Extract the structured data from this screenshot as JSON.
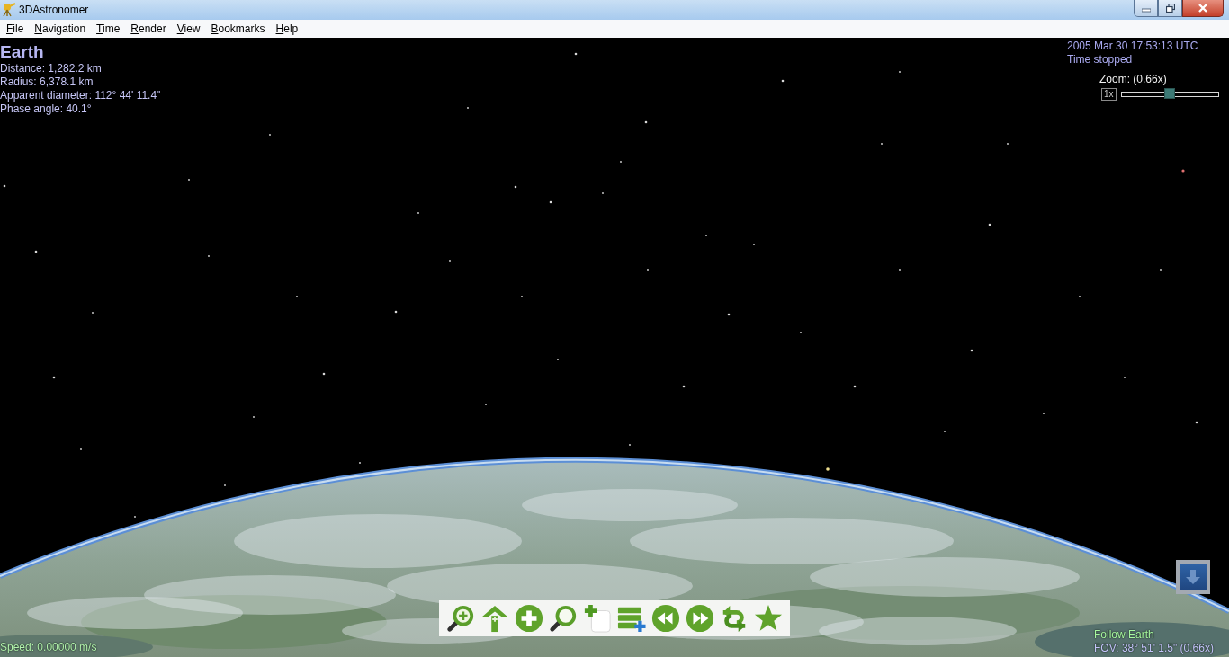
{
  "window": {
    "title": "3DAstronomer",
    "controls": [
      {
        "kind": "minimize"
      },
      {
        "kind": "restore"
      },
      {
        "kind": "close"
      }
    ]
  },
  "menu": [
    "File",
    "Navigation",
    "Time",
    "Render",
    "View",
    "Bookmarks",
    "Help"
  ],
  "object_info": {
    "name": "Earth",
    "lines": [
      "Distance: 1,282.2 km",
      "Radius: 6,378.1 km",
      "Apparent diameter: 112° 44' 11.4\"",
      "Phase angle: 40.1°"
    ]
  },
  "time_info": {
    "datetime": "2005 Mar 30 17:53:13 UTC",
    "status": "Time stopped"
  },
  "zoom": {
    "label": "Zoom: (0.66x)",
    "reset": "1x",
    "level": 0.5
  },
  "toolbar": [
    {
      "kind": "zoom-in"
    },
    {
      "kind": "up"
    },
    {
      "kind": "add"
    },
    {
      "kind": "search"
    },
    {
      "kind": "new-page"
    },
    {
      "kind": "add-list"
    },
    {
      "kind": "rewind"
    },
    {
      "kind": "fast-forward"
    },
    {
      "kind": "swap"
    },
    {
      "kind": "star"
    }
  ],
  "corner_button": {
    "kind": "down"
  },
  "status": {
    "speed": "Speed: 0.00000 m/s",
    "follow": "Follow Earth",
    "fov": "FOV: 38° 51' 1.5\" (0.66x)"
  }
}
